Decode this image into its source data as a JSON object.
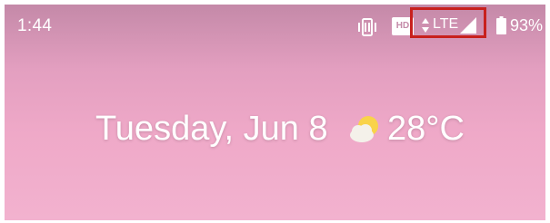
{
  "status_bar": {
    "time": "1:44",
    "hd_label": "HD",
    "network_type": "LTE",
    "battery_percent": "93%",
    "highlight_color": "#c8201d",
    "icons": [
      "vibrate-icon",
      "hd-icon",
      "data-arrows-icon",
      "signal-icon",
      "battery-icon"
    ]
  },
  "glance": {
    "date": "Tuesday, Jun 8",
    "weather_icon": "partly-cloudy-icon",
    "temperature": "28°C"
  },
  "colors": {
    "wallpaper_top": "#c489a8",
    "wallpaper_bottom": "#f2b2cf",
    "text": "#ffffff"
  }
}
